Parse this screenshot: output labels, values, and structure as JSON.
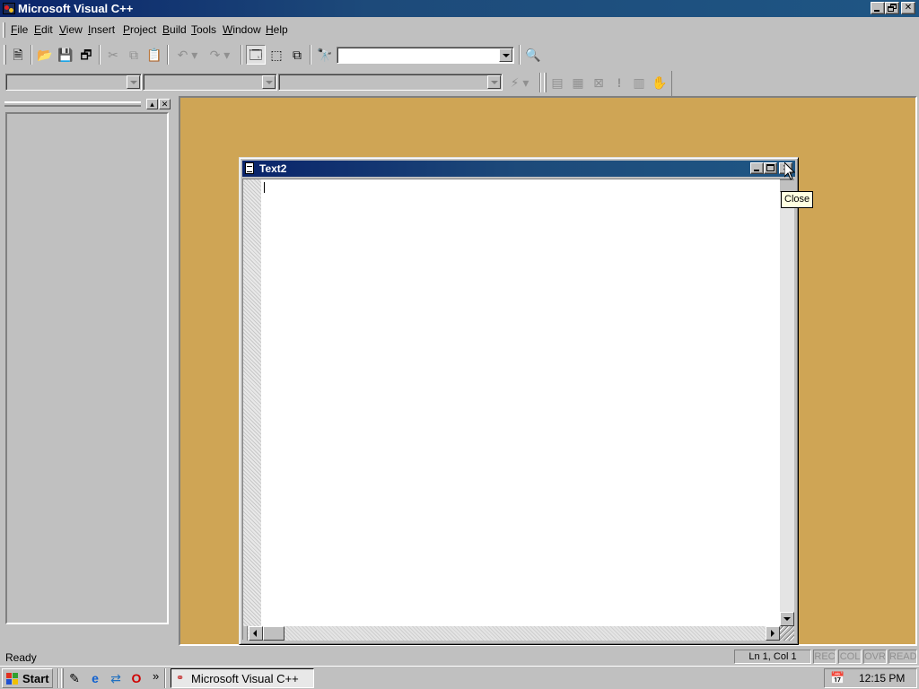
{
  "app": {
    "title": "Microsoft Visual C++"
  },
  "menubar": {
    "items": [
      {
        "label": "File",
        "accel": "F",
        "rest": "ile"
      },
      {
        "label": "Edit",
        "accel": "E",
        "rest": "dit"
      },
      {
        "label": "View",
        "accel": "V",
        "rest": "iew"
      },
      {
        "label": "Insert",
        "accel": "I",
        "rest": "nsert"
      },
      {
        "label": "Project",
        "accel": "P",
        "rest": "roject"
      },
      {
        "label": "Build",
        "accel": "B",
        "rest": "uild"
      },
      {
        "label": "Tools",
        "accel": "T",
        "rest": "ools"
      },
      {
        "label": "Window",
        "accel": "W",
        "rest": "indow"
      },
      {
        "label": "Help",
        "accel": "H",
        "rest": "elp"
      }
    ]
  },
  "toolbar": {
    "find_combo_value": "",
    "icons": [
      "new-text-file-icon",
      "open-icon",
      "save-icon",
      "save-all-icon",
      "cut-icon",
      "copy-icon",
      "paste-icon",
      "undo-icon",
      "redo-icon",
      "workspace-icon",
      "output-icon",
      "window-list-icon",
      "find-in-files-icon",
      "find-icon"
    ]
  },
  "wizardbar": {
    "class_combo": "",
    "filter_combo": "",
    "members_combo": "",
    "icons": [
      "wizard-action-icon",
      "compile-icon",
      "build-icon",
      "stop-build-icon",
      "execute-icon",
      "go-icon",
      "breakpoint-icon"
    ]
  },
  "child_window": {
    "title": "Text2",
    "editor_text": ""
  },
  "tooltip": {
    "text": "Close"
  },
  "statusbar": {
    "status": "Ready",
    "position": "Ln 1, Col 1",
    "indicators": [
      "REC",
      "COL",
      "OVR",
      "READ"
    ]
  },
  "taskbar": {
    "start_label": "Start",
    "quicklaunch_more": "»",
    "task_label": "Microsoft Visual C++",
    "clock": "12:15 PM"
  },
  "colors": {
    "titlebar_active": "#0a246a",
    "mdi_background": "#cfa555",
    "tooltip_bg": "#ffffe1"
  }
}
